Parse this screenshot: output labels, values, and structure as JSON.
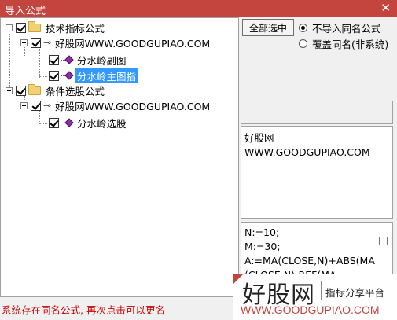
{
  "window": {
    "title": "导入公式",
    "close_glyph": "✕"
  },
  "tree": {
    "nodes": [
      {
        "label": "技术指标公式",
        "kind": "folder",
        "checked": true
      },
      {
        "label": "好股网WWW.GOODGUPIAO.COM",
        "kind": "group",
        "checked": true
      },
      {
        "label": "分水岭副图",
        "kind": "formula",
        "checked": true
      },
      {
        "label": "分水岭主图指",
        "kind": "formula",
        "checked": true,
        "selected": true
      },
      {
        "label": "条件选股公式",
        "kind": "folder",
        "checked": true
      },
      {
        "label": "好股网WWW.GOODGUPIAO.COM",
        "kind": "group",
        "checked": true
      },
      {
        "label": "分水岭选股",
        "kind": "formula",
        "checked": true
      }
    ]
  },
  "options": {
    "select_all_label": "全部选中",
    "radio_skip": "不导入同名公式",
    "radio_overwrite": "覆盖同名(非系统)",
    "selected": "skip"
  },
  "info": {
    "line1": "好股网",
    "line2": "WWW.GOODGUPIAO.COM"
  },
  "code": {
    "lines": [
      "N:=10;",
      "M:=30;",
      "A:=MA(CLOSE,N)+ABS(MA",
      "(CLOSE,N)-REF(MA"
    ]
  },
  "status": {
    "text": "系统存在同名公式, 再次点击可以更名"
  },
  "watermark": {
    "brand": "好股网",
    "tagline": "指标分享平台",
    "url": "WWW.GOODGUPIAO.COM"
  },
  "colors": {
    "accent": "#c4443e",
    "selection": "#3399ff",
    "status_text": "#c80000"
  },
  "icons": {
    "folder": "folder-icon",
    "key": "key-icon",
    "formula": "formula-diamond-icon"
  }
}
